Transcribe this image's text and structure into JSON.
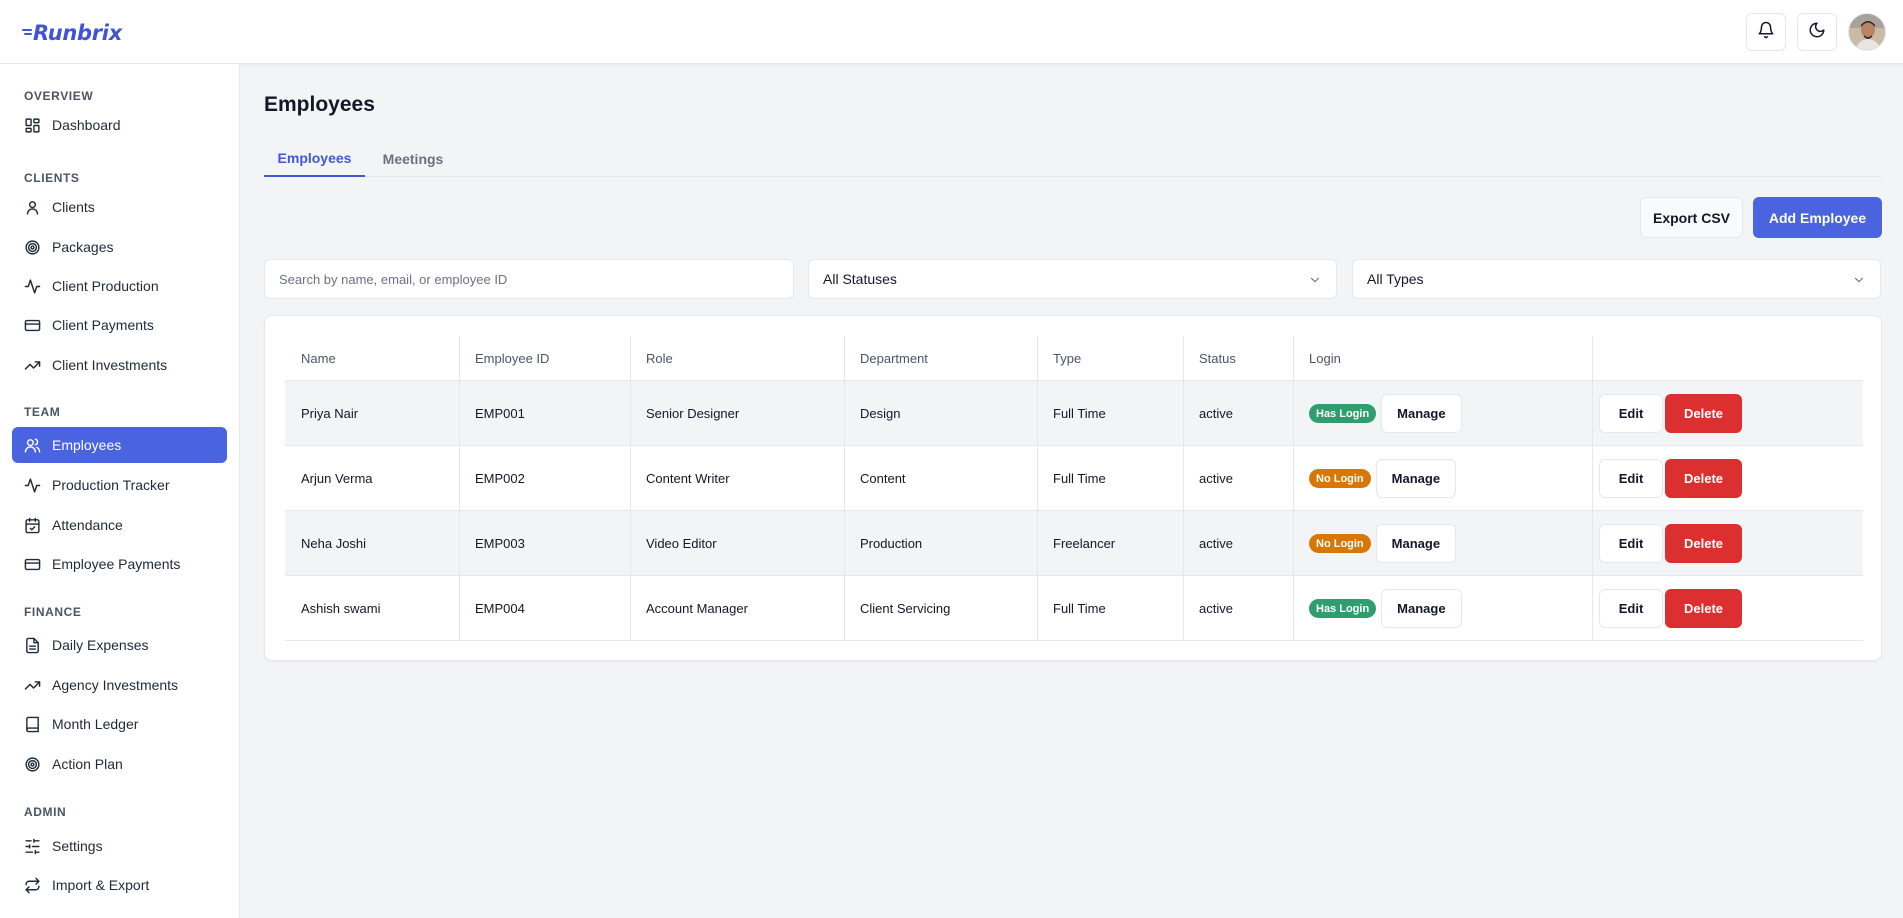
{
  "app": {
    "logo_text": "Runbrix"
  },
  "header": {
    "icons": [
      "bell-icon",
      "moon-icon"
    ],
    "avatar": "user-avatar"
  },
  "sidebar": {
    "sections": [
      {
        "label": "OVERVIEW",
        "items": [
          {
            "label": "Dashboard",
            "icon": "grid-icon"
          }
        ]
      },
      {
        "label": "CLIENTS",
        "items": [
          {
            "label": "Clients",
            "icon": "user-icon"
          },
          {
            "label": "Packages",
            "icon": "target-icon"
          },
          {
            "label": "Client Production",
            "icon": "activity-icon"
          },
          {
            "label": "Client Payments",
            "icon": "credit-card-icon"
          },
          {
            "label": "Client Investments",
            "icon": "trending-up-icon"
          }
        ]
      },
      {
        "label": "TEAM",
        "items": [
          {
            "label": "Employees",
            "icon": "users-icon",
            "active": true
          },
          {
            "label": "Production Tracker",
            "icon": "activity-icon"
          },
          {
            "label": "Attendance",
            "icon": "calendar-check-icon"
          },
          {
            "label": "Employee Payments",
            "icon": "credit-card-icon"
          }
        ]
      },
      {
        "label": "FINANCE",
        "items": [
          {
            "label": "Daily Expenses",
            "icon": "file-text-icon"
          },
          {
            "label": "Agency Investments",
            "icon": "trending-up-icon"
          },
          {
            "label": "Month Ledger",
            "icon": "book-icon"
          },
          {
            "label": "Action Plan",
            "icon": "target-icon"
          }
        ]
      },
      {
        "label": "ADMIN",
        "items": [
          {
            "label": "Settings",
            "icon": "sliders-icon"
          },
          {
            "label": "Import & Export",
            "icon": "repeat-icon"
          }
        ]
      }
    ]
  },
  "main": {
    "title": "Employees",
    "tabs": [
      {
        "label": "Employees",
        "active": true
      },
      {
        "label": "Meetings",
        "active": false
      }
    ],
    "actions": {
      "export_label": "Export CSV",
      "add_label": "Add Employee"
    },
    "filters": {
      "search_placeholder": "Search by name, email, or employee ID",
      "status_selected": "All Statuses",
      "type_selected": "All Types"
    },
    "table": {
      "columns": [
        "Name",
        "Employee ID",
        "Role",
        "Department",
        "Type",
        "Status",
        "Login",
        ""
      ],
      "rows": [
        {
          "name": "Priya Nair",
          "id": "EMP001",
          "role": "Senior Designer",
          "department": "Design",
          "type": "Full Time",
          "status": "active",
          "login": "Has Login",
          "login_color": "#2f9e6e",
          "manage": "Manage",
          "edit": "Edit",
          "delete": "Delete"
        },
        {
          "name": "Arjun Verma",
          "id": "EMP002",
          "role": "Content Writer",
          "department": "Content",
          "type": "Full Time",
          "status": "active",
          "login": "No Login",
          "login_color": "#d97706",
          "manage": "Manage",
          "edit": "Edit",
          "delete": "Delete"
        },
        {
          "name": "Neha Joshi",
          "id": "EMP003",
          "role": "Video Editor",
          "department": "Production",
          "type": "Freelancer",
          "status": "active",
          "login": "No Login",
          "login_color": "#d97706",
          "manage": "Manage",
          "edit": "Edit",
          "delete": "Delete"
        },
        {
          "name": "Ashish swami",
          "id": "EMP004",
          "role": "Account Manager",
          "department": "Client Servicing",
          "type": "Full Time",
          "status": "active",
          "login": "Has Login",
          "login_color": "#2f9e6e",
          "manage": "Manage",
          "edit": "Edit",
          "delete": "Delete"
        }
      ]
    }
  },
  "colors": {
    "accent": "#4a63e0",
    "danger": "#dc2f2f",
    "success": "#2f9e6e",
    "warning": "#d97706"
  }
}
